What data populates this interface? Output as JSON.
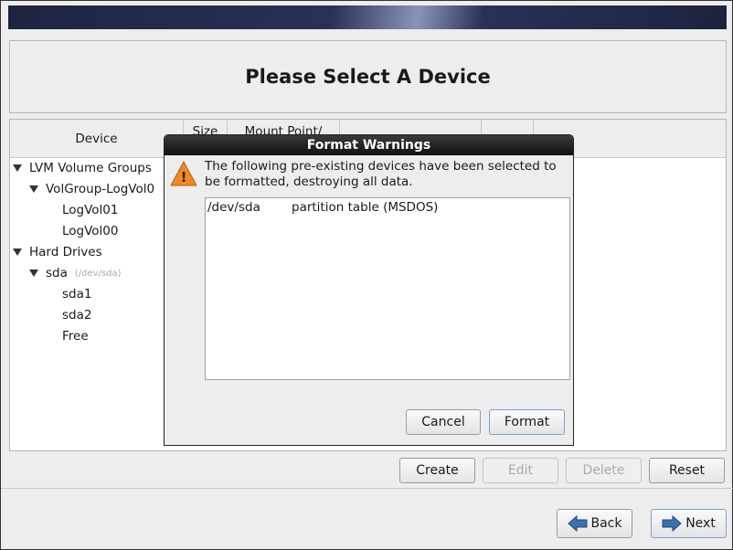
{
  "header": {
    "title": "Please Select A Device"
  },
  "columns": [
    "Device",
    "Size",
    "Mount Point/"
  ],
  "tree": [
    {
      "label": "LVM Volume Groups",
      "level": 0,
      "expanded": true
    },
    {
      "label": "VolGroup-LogVol0",
      "level": 1,
      "expanded": true
    },
    {
      "label": "LogVol01",
      "level": 2
    },
    {
      "label": "LogVol00",
      "level": 2
    },
    {
      "label": "Hard Drives",
      "level": 0,
      "expanded": true
    },
    {
      "label": "sda",
      "sub": "(/dev/sda)",
      "level": 1,
      "expanded": true
    },
    {
      "label": "sda1",
      "level": 2
    },
    {
      "label": "sda2",
      "level": 2
    },
    {
      "label": "Free",
      "level": 2
    }
  ],
  "actions": {
    "create": "Create",
    "edit": "Edit",
    "delete": "Delete",
    "reset": "Reset"
  },
  "nav": {
    "back": "Back",
    "next": "Next"
  },
  "dialog": {
    "title": "Format Warnings",
    "message": "The following pre-existing devices have been selected to be formatted, destroying all data.",
    "items": [
      {
        "device": "/dev/sda",
        "description": "partition table (MSDOS)"
      }
    ],
    "cancel": "Cancel",
    "format": "Format"
  }
}
